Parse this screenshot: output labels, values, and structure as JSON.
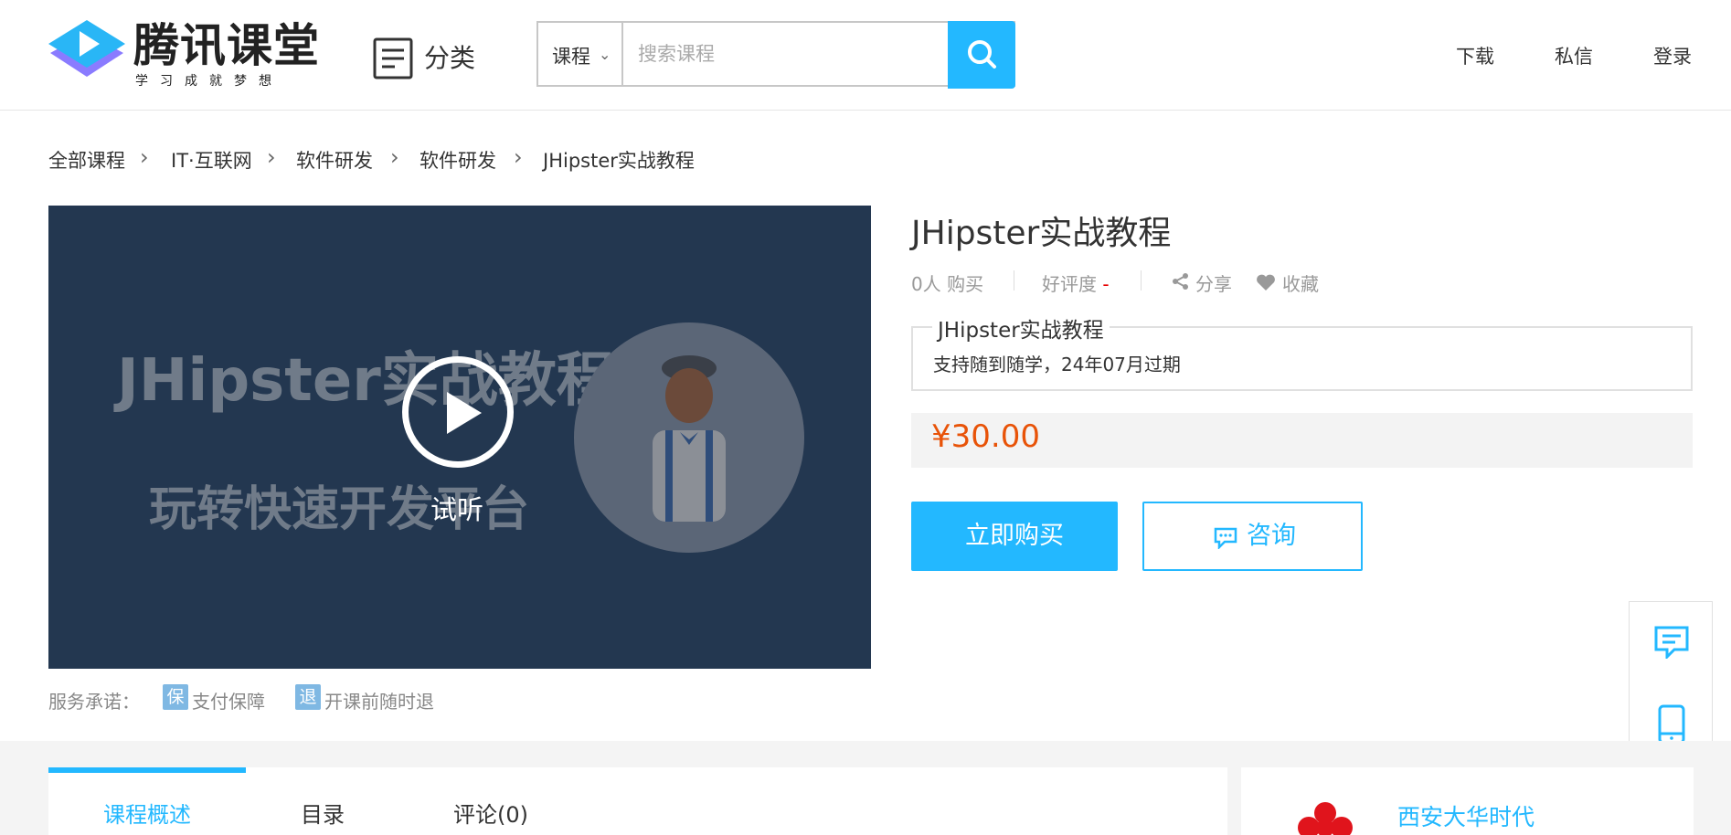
{
  "header": {
    "logo_text": "腾讯课堂",
    "logo_slogan": "学习成就梦想",
    "category_label": "分类",
    "search": {
      "type_label": "课程",
      "placeholder": "搜索课程"
    },
    "nav": [
      "下载",
      "私信",
      "登录"
    ]
  },
  "breadcrumb": [
    "全部课程",
    "IT·互联网",
    "软件研发",
    "软件研发",
    "JHipster实战教程"
  ],
  "video": {
    "title_text": "JHipster实战教程",
    "subtitle_text": "玩转快速开发平台",
    "try_label": "试听"
  },
  "service": {
    "label": "服务承诺：",
    "items": [
      {
        "icon_char": "保",
        "text": "支付保障"
      },
      {
        "icon_char": "退",
        "text": "开课前随时退"
      }
    ]
  },
  "course": {
    "title": "JHipster实战教程",
    "buyers": "0人 购买",
    "rating_label": "好评度",
    "rating_value": "-",
    "share_label": "分享",
    "favorite_label": "收藏",
    "package_title": "JHipster实战教程",
    "package_desc": "支持随到随学，24年07月过期",
    "price": "¥30.00",
    "buy_label": "立即购买",
    "consult_label": "咨询"
  },
  "tabs": [
    {
      "label": "课程概述",
      "active": true
    },
    {
      "label": "目录",
      "active": false
    },
    {
      "label": "评论(0)",
      "active": false
    }
  ],
  "org": {
    "name": "西安大华时代"
  },
  "colors": {
    "accent": "#23b8ff",
    "price": "#e85308",
    "video_bg": "#233750"
  }
}
